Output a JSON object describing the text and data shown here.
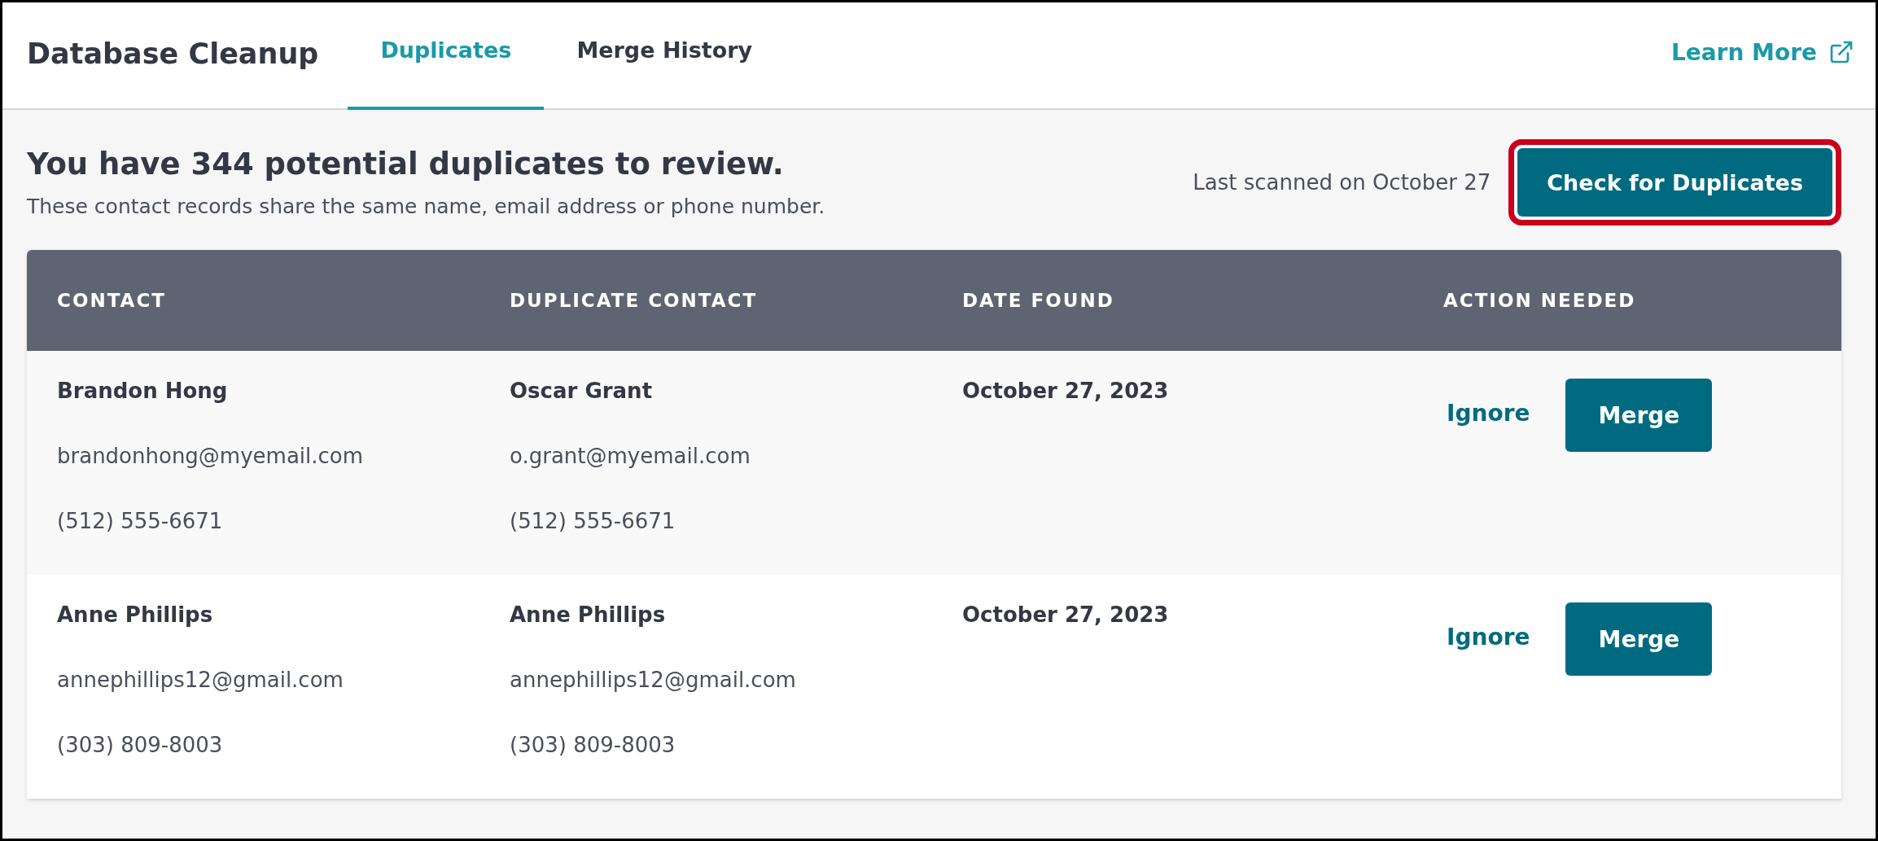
{
  "app_title": "Database Cleanup",
  "tabs": [
    {
      "label": "Duplicates",
      "selected": true
    },
    {
      "label": "Merge History",
      "selected": false
    }
  ],
  "learn_more": "Learn More",
  "heading": "You have 344 potential duplicates to review.",
  "subheading": "These contact records share the same name, email address or phone number.",
  "last_scanned": "Last scanned on October 27",
  "check_button": {
    "label": "Check for Duplicates",
    "highlighted": true
  },
  "table": {
    "columns": [
      "CONTACT",
      "DUPLICATE CONTACT",
      "DATE FOUND",
      "ACTION NEEDED"
    ],
    "rows": [
      {
        "contact": {
          "name": "Brandon Hong",
          "email": "brandonhong@myemail.com",
          "phone": "(512) 555-6671"
        },
        "duplicate": {
          "name": "Oscar Grant",
          "email": "o.grant@myemail.com",
          "phone": "(512) 555-6671"
        },
        "date_found": "October 27, 2023",
        "ignore": "Ignore",
        "merge": "Merge"
      },
      {
        "contact": {
          "name": "Anne Phillips",
          "email": "annephillips12@gmail.com",
          "phone": "(303) 809-8003"
        },
        "duplicate": {
          "name": "Anne Phillips",
          "email": "annephillips12@gmail.com",
          "phone": "(303) 809-8003"
        },
        "date_found": "October 27, 2023",
        "ignore": "Ignore",
        "merge": "Merge"
      }
    ]
  }
}
